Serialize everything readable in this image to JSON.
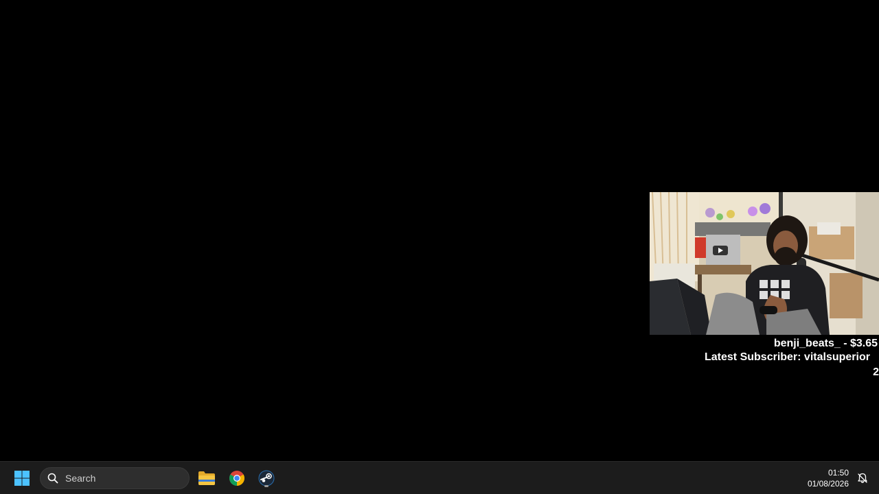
{
  "stream_overlay": {
    "latest_donation": "benji_beats_ - $3.65",
    "latest_subscriber": "Latest Subscriber: vitalsuperior",
    "subscriber_count": "2"
  },
  "taskbar": {
    "start_icon": "windows-logo",
    "search": {
      "placeholder": "Search",
      "icon": "search-icon"
    },
    "pinned_apps": [
      {
        "name": "File Explorer",
        "icon": "folder-icon"
      },
      {
        "name": "Google Chrome",
        "icon": "chrome-icon"
      },
      {
        "name": "Steam",
        "icon": "steam-icon",
        "running": true
      }
    ],
    "clock": {
      "time": "01:50",
      "date": "01/08/2026"
    },
    "notification_icon": "notification-bell-icon"
  },
  "colors": {
    "desktop_background": "#000000",
    "taskbar_background": "#1c1c1c",
    "windows_blue": "#4cc2ff",
    "folder_yellow": "#f5c542",
    "steam_blue": "#1b2838"
  }
}
